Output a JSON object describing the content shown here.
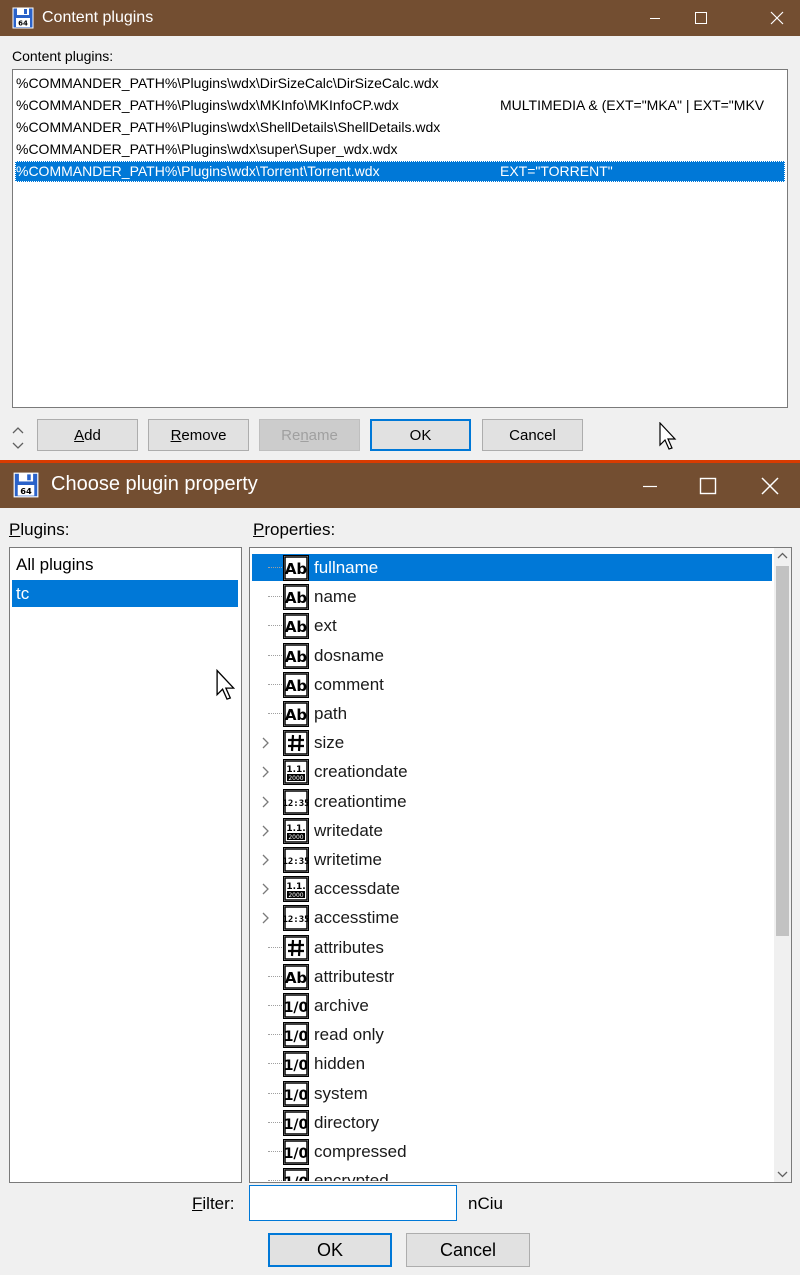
{
  "colors": {
    "titlebar": "#734e31",
    "selection": "#0078d7",
    "divider": "#d83b01"
  },
  "window1": {
    "title": "Content plugins",
    "icon": "floppy-disk-64-icon",
    "label": "Content plugins:",
    "plugins": [
      {
        "path": "%COMMANDER_PATH%\\Plugins\\wdx\\DirSizeCalc\\DirSizeCalc.wdx",
        "detect": "",
        "selected": false
      },
      {
        "path": "%COMMANDER_PATH%\\Plugins\\wdx\\MKInfo\\MKInfoCP.wdx",
        "detect": "MULTIMEDIA & (EXT=\"MKA\" | EXT=\"MKV",
        "selected": false
      },
      {
        "path": "%COMMANDER_PATH%\\Plugins\\wdx\\ShellDetails\\ShellDetails.wdx",
        "detect": "",
        "selected": false
      },
      {
        "path": "%COMMANDER_PATH%\\Plugins\\wdx\\super\\Super_wdx.wdx",
        "detect": "",
        "selected": false
      },
      {
        "path": "%COMMANDER_PATH%\\Plugins\\wdx\\Torrent\\Torrent.wdx",
        "detect": "EXT=\"TORRENT\"",
        "selected": true
      }
    ],
    "buttons": {
      "add": {
        "mn": "A",
        "rest": "dd"
      },
      "remove": {
        "mn": "R",
        "rest": "emove"
      },
      "rename": {
        "pre": "Re",
        "mn": "n",
        "rest": "ame"
      },
      "ok": "OK",
      "cancel": "Cancel"
    }
  },
  "window2": {
    "title": "Choose plugin property",
    "icon": "floppy-disk-64-icon",
    "plugins_label": {
      "mn": "P",
      "rest": "lugins:"
    },
    "properties_label": {
      "mn": "P",
      "rest": "roperties:"
    },
    "plugins": [
      {
        "label": "All plugins",
        "selected": false
      },
      {
        "label": "tc",
        "selected": true
      }
    ],
    "properties": [
      {
        "label": "fullname",
        "type": "Ab",
        "expandable": false,
        "selected": true
      },
      {
        "label": "name",
        "type": "Ab",
        "expandable": false,
        "selected": false
      },
      {
        "label": "ext",
        "type": "Ab",
        "expandable": false,
        "selected": false
      },
      {
        "label": "dosname",
        "type": "Ab",
        "expandable": false,
        "selected": false
      },
      {
        "label": "comment",
        "type": "Ab",
        "expandable": false,
        "selected": false
      },
      {
        "label": "path",
        "type": "Ab",
        "expandable": false,
        "selected": false
      },
      {
        "label": "size",
        "type": "#",
        "expandable": true,
        "selected": false
      },
      {
        "label": "creationdate",
        "type": "date",
        "expandable": true,
        "selected": false
      },
      {
        "label": "creationtime",
        "type": "time",
        "expandable": true,
        "selected": false
      },
      {
        "label": "writedate",
        "type": "date",
        "expandable": true,
        "selected": false
      },
      {
        "label": "writetime",
        "type": "time",
        "expandable": true,
        "selected": false
      },
      {
        "label": "accessdate",
        "type": "date",
        "expandable": true,
        "selected": false
      },
      {
        "label": "accesstime",
        "type": "time",
        "expandable": true,
        "selected": false
      },
      {
        "label": "attributes",
        "type": "#",
        "expandable": false,
        "selected": false
      },
      {
        "label": "attributestr",
        "type": "Ab",
        "expandable": false,
        "selected": false
      },
      {
        "label": "archive",
        "type": "1/0",
        "expandable": false,
        "selected": false
      },
      {
        "label": "read only",
        "type": "1/0",
        "expandable": false,
        "selected": false
      },
      {
        "label": "hidden",
        "type": "1/0",
        "expandable": false,
        "selected": false
      },
      {
        "label": "system",
        "type": "1/0",
        "expandable": false,
        "selected": false
      },
      {
        "label": "directory",
        "type": "1/0",
        "expandable": false,
        "selected": false
      },
      {
        "label": "compressed",
        "type": "1/0",
        "expandable": false,
        "selected": false
      },
      {
        "label": "encrypted",
        "type": "1/0",
        "expandable": false,
        "selected": false
      }
    ],
    "filter_label": {
      "mn": "F",
      "rest": "ilter:"
    },
    "filter_value": "",
    "filter_hint": "nCiu",
    "buttons": {
      "ok": "OK",
      "cancel": "Cancel"
    }
  }
}
